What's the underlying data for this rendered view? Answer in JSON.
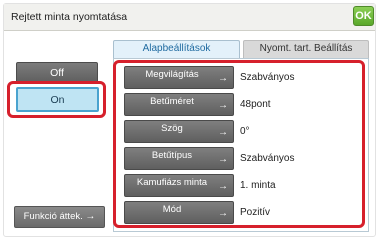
{
  "window": {
    "title": "Rejtett minta nyomtatása",
    "ok_label": "OK"
  },
  "tabs": [
    {
      "label": "Alapbeállítások",
      "active": true
    },
    {
      "label": "Nyomt. tart. Beállítás",
      "active": false
    }
  ],
  "toggle": {
    "off_label": "Off",
    "on_label": "On",
    "selected": "On"
  },
  "function_review": {
    "label": "Funkció áttek.",
    "arrow": "→"
  },
  "settings": [
    {
      "label": "Megvilágítás",
      "value": "Szabványos"
    },
    {
      "label": "Betűméret",
      "value": "48pont"
    },
    {
      "label": "Szög",
      "value": "0°"
    },
    {
      "label": "Betűtípus",
      "value": "Szabványos"
    },
    {
      "label": "Kamufiázs minta",
      "value": "1. minta"
    },
    {
      "label": "Mód",
      "value": "Pozitív"
    }
  ],
  "row_arrow": "→",
  "colors": {
    "accent_green": "#5aa82a",
    "highlight_red": "#d6202c",
    "selected_blue": "#bfe4f3",
    "tab_active_text": "#1f6aa0"
  }
}
